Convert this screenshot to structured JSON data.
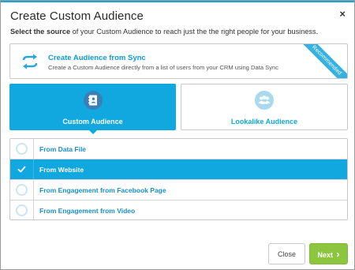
{
  "dialog": {
    "title": "Create Custom Audience",
    "close_glyph": "×",
    "subtitle_bold": "Select the source",
    "subtitle_rest": " of your Custom Audience to reach just the the right people for your business."
  },
  "sync": {
    "title": "Create Audience from Sync",
    "description": "Create a Custom Audience directly from a list of users from your CRM using Data Sync",
    "ribbon": "Recommended",
    "icon": "sync-arrows-icon"
  },
  "tiles": [
    {
      "label": "Custom Audience",
      "icon": "contact-book-icon",
      "selected": true
    },
    {
      "label": "Lookalike Audience",
      "icon": "people-group-icon",
      "selected": false
    }
  ],
  "options": [
    {
      "label": "From Data File",
      "selected": false
    },
    {
      "label": "From Website",
      "selected": true
    },
    {
      "label": "From Engagement from Facebook Page",
      "selected": false
    },
    {
      "label": "From Engagement from Video",
      "selected": false
    }
  ],
  "footer": {
    "close_label": "Close",
    "next_label": "Next",
    "next_chevron": "›"
  },
  "colors": {
    "accent": "#11a8e0",
    "next_button": "#8cc63f"
  }
}
